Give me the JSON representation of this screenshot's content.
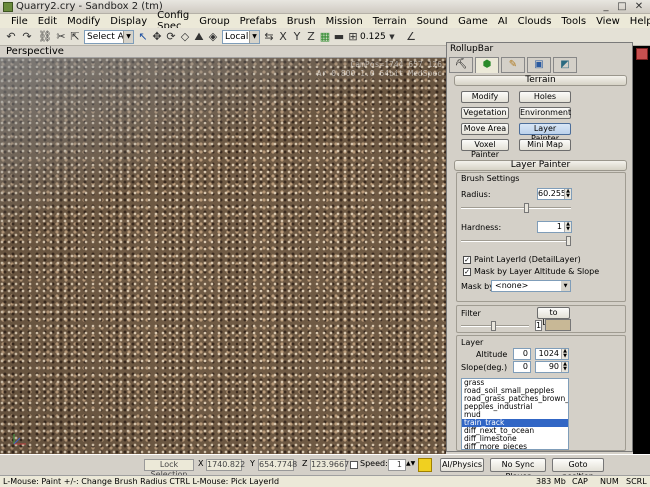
{
  "window": {
    "title": "Quarry2.cry - Sandbox 2 (tm)",
    "min": "_",
    "max": "□",
    "close": "✕"
  },
  "menu": [
    "File",
    "Edit",
    "Modify",
    "Display",
    "Config Spec",
    "Group",
    "Prefabs",
    "Brush",
    "Mission",
    "Terrain",
    "Sound",
    "Game",
    "AI",
    "Clouds",
    "Tools",
    "View",
    "Help"
  ],
  "toolbar": {
    "selection_filter": "Select All",
    "coord_system": "Local",
    "axis_x": "X",
    "axis_y": "Y",
    "axis_z": "Z",
    "grid_size": "0.125"
  },
  "viewport": {
    "title": "Perspective",
    "campos_line1": "CamPos=1744 657 126",
    "campos_line2": "Ar 0.800 1.0 64bit MedSpec"
  },
  "rollup": {
    "title": "RollupBar",
    "tabs": [
      "create-tab",
      "terrain-tab",
      "modelling-tab",
      "display-tab",
      "layers-tab"
    ],
    "terrain_header": "Terrain",
    "buttons": [
      "Modify",
      "Holes",
      "Vegetation",
      "Environment",
      "Move Area",
      "Layer Painter",
      "Voxel Painter",
      "Mini Map"
    ],
    "selected_button": "Layer Painter",
    "layer_painter_header": "Layer Painter",
    "brush_settings_label": "Brush Settings",
    "radius_label": "Radius:",
    "radius_value": "60.255",
    "radius_fraction": 0.6,
    "hardness_label": "Hardness:",
    "hardness_value": "1",
    "hardness_fraction": 1.0,
    "paint_layer_label": "Paint LayerId (DetailLayer)",
    "mask_altitude_label": "Mask by Layer Altitude & Slope",
    "mask_by_label": "Mask by",
    "mask_by_value": "<none>",
    "filter_label": "Filter",
    "to_layer_label": "to Layer",
    "filter_value": "1",
    "filter_color": "#c8b896",
    "layer_label": "Layer",
    "altitude_label": "Altitude",
    "altitude_min": "0",
    "altitude_max": "1024",
    "slope_label": "Slope(deg.)",
    "slope_min": "0",
    "slope_max": "90",
    "layers": [
      "grass",
      "road_soil_small_pepples",
      "road_grass_patches_brown_soil",
      "pepples_industrial",
      "mud",
      "train_track",
      "diff_next_to_ocean",
      "diff_limestone",
      "diff_more_pieces"
    ],
    "selected_layer": "train_track"
  },
  "bottom": {
    "lock_selection": "Lock Selection",
    "x_label": "X",
    "x_value": "1740.822",
    "y_label": "Y",
    "y_value": "654.7748",
    "z_label": "Z",
    "z_value": "123.9667",
    "speed_label": "Speed:",
    "speed_value": "1",
    "ai_physics": "AI/Physics",
    "no_sync_player": "No Sync Player",
    "goto_position": "Goto position"
  },
  "status": {
    "hint": "L-Mouse: Paint   +/-: Change Brush Radius   CTRL L-Mouse: Pick LayerId",
    "memory": "383 Mb",
    "cap": "CAP",
    "num": "NUM",
    "scrl": "SCRL"
  },
  "colors": {
    "selection_blue": "#3166c5",
    "rock": "#6f5a44"
  }
}
